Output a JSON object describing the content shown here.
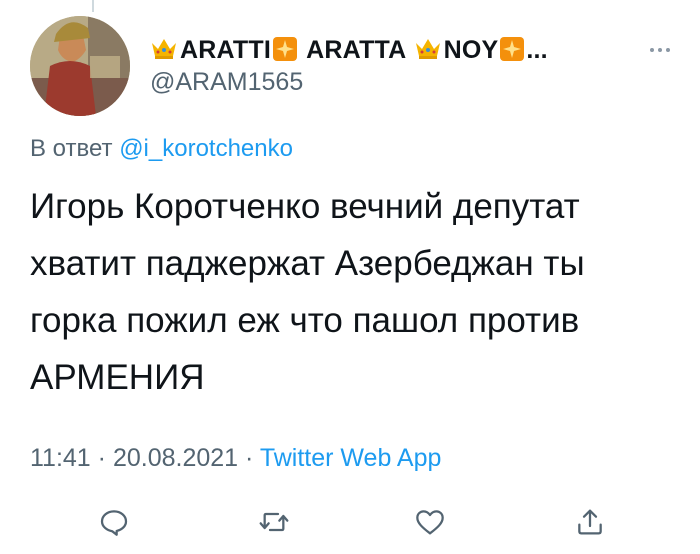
{
  "tweet": {
    "display_name_parts": [
      "ARATTI",
      "ARATTA",
      "NOY",
      "..."
    ],
    "handle": "@ARAM1565",
    "reply_prefix": "В ответ",
    "reply_mention": "@i_korotchenko",
    "text": "Игорь Коротченко вечний депутат\nхватит паджержат Азербеджан ты\nгорка пожил еж что пашол против\nАРМЕНИЯ",
    "time": "11:41",
    "date": "20.08.2021",
    "separator": " · ",
    "source": "Twitter Web App"
  },
  "icons": {
    "more": "more-horizontal-icon",
    "reply": "reply-icon",
    "retweet": "retweet-icon",
    "like": "like-icon",
    "share": "share-icon"
  },
  "colors": {
    "accent": "#1d9bf0",
    "secondary_text": "#536471",
    "icon": "#536471",
    "crown": "#f5b400",
    "spark_bg": "#f4900c"
  }
}
